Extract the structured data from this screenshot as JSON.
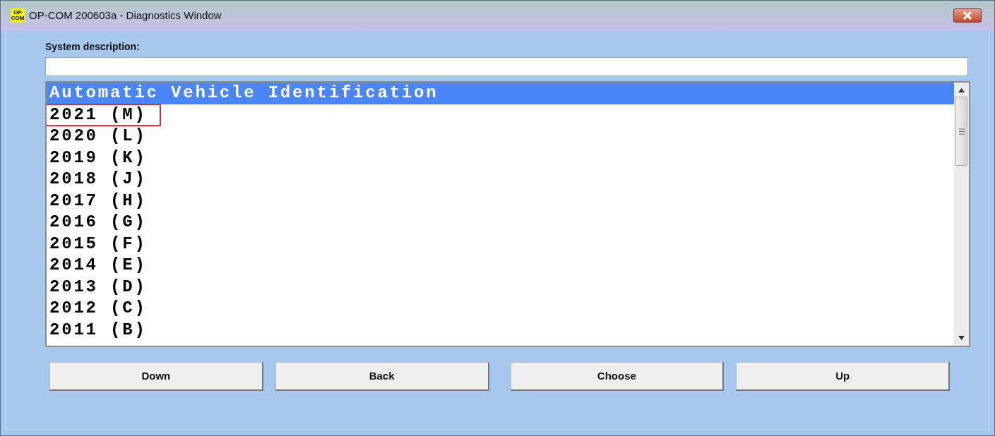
{
  "window": {
    "logo": [
      "OP",
      "COM"
    ],
    "title": "OP-COM 200603a - Diagnostics Window"
  },
  "system_description": {
    "label": "System description:"
  },
  "list": {
    "items": [
      {
        "text": "Automatic Vehicle Identification",
        "selected": true,
        "highlighted": false
      },
      {
        "text": "2021 (M)",
        "selected": false,
        "highlighted": true
      },
      {
        "text": "2020 (L)",
        "selected": false,
        "highlighted": false
      },
      {
        "text": "2019 (K)",
        "selected": false,
        "highlighted": false
      },
      {
        "text": "2018 (J)",
        "selected": false,
        "highlighted": false
      },
      {
        "text": "2017 (H)",
        "selected": false,
        "highlighted": false
      },
      {
        "text": "2016 (G)",
        "selected": false,
        "highlighted": false
      },
      {
        "text": "2015 (F)",
        "selected": false,
        "highlighted": false
      },
      {
        "text": "2014 (E)",
        "selected": false,
        "highlighted": false
      },
      {
        "text": "2013 (D)",
        "selected": false,
        "highlighted": false
      },
      {
        "text": "2012 (C)",
        "selected": false,
        "highlighted": false
      },
      {
        "text": "2011 (B)",
        "selected": false,
        "highlighted": false
      }
    ]
  },
  "buttons": [
    "Down",
    "Back",
    "Choose",
    "Up"
  ]
}
